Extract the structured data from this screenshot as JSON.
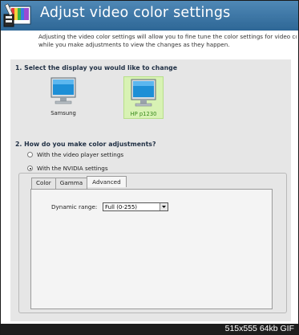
{
  "header": {
    "title": "Adjust video color settings",
    "icon": "video-color-settings-icon"
  },
  "intro": {
    "line1": "Adjusting the video color settings will allow you to fine tune the color settings for video content o",
    "line2": "while you make adjustments to view the changes as they happen."
  },
  "section1": {
    "heading": "1. Select the display you would like to change",
    "displays": [
      {
        "label": "Samsung",
        "selected": false,
        "icon": "monitor-icon"
      },
      {
        "label": "HP p1230",
        "selected": true,
        "icon": "monitor-icon"
      }
    ]
  },
  "section2": {
    "heading": "2. How do you make color adjustments?",
    "options": [
      {
        "label": "With the video player settings",
        "checked": false
      },
      {
        "label": "With the NVIDIA settings",
        "checked": true
      }
    ]
  },
  "tabs": [
    {
      "label": "Color",
      "active": false
    },
    {
      "label": "Gamma",
      "active": false
    },
    {
      "label": "Advanced",
      "active": true
    }
  ],
  "advanced": {
    "dynamic_range_label": "Dynamic range:",
    "dynamic_range_value": "Full (0-255)"
  },
  "footer": {
    "text": "515x555 64kb GIF"
  },
  "colors": {
    "header_bg": "#3a77a8",
    "selected_display_bg": "#d8f2b4",
    "selected_display_text": "#3a8a1d"
  }
}
